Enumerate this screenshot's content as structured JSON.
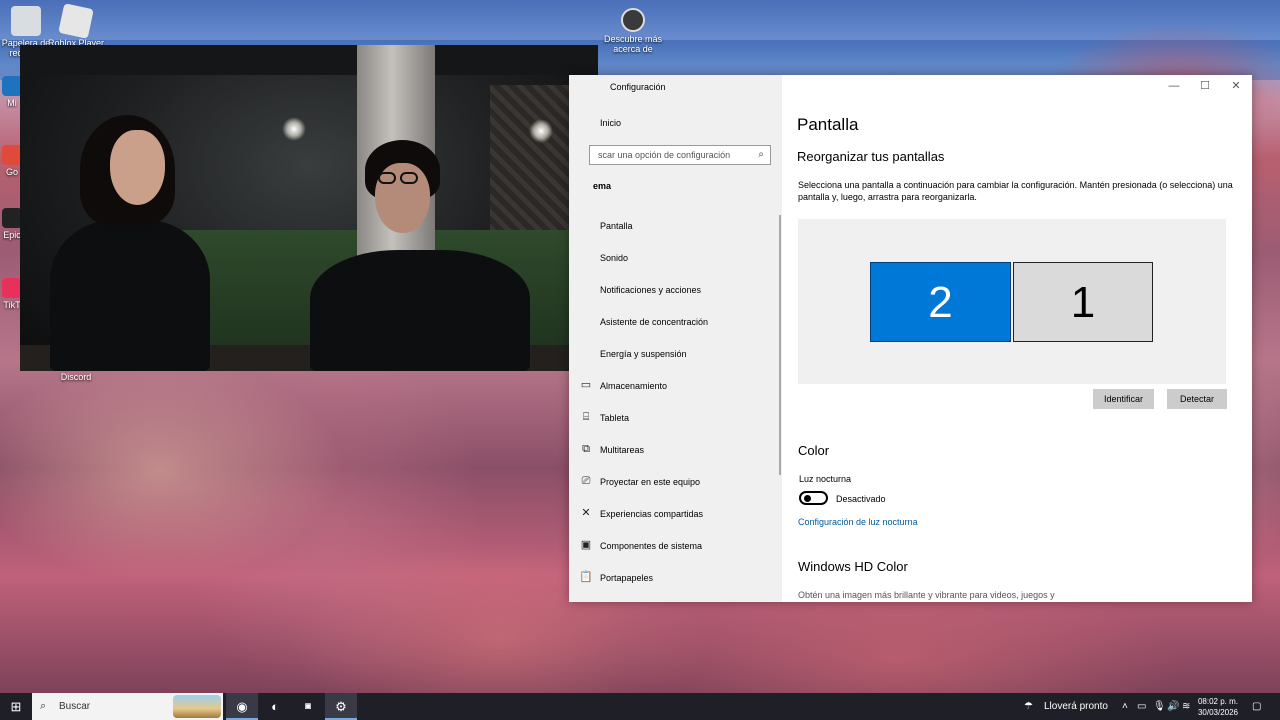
{
  "desktop": {
    "icons": [
      {
        "label": "Papelera de reciclaje",
        "color": "#dcdcdc"
      },
      {
        "label": "Roblox Player",
        "color": "#e8e8e8"
      },
      {
        "label": "Descubre más acerca de",
        "color": "#3a3a3a"
      },
      {
        "label": "Mi",
        "color": "#1e73be"
      },
      {
        "label": "Go",
        "color": "#e04a3a"
      },
      {
        "label": "Epic",
        "color": "#222222"
      },
      {
        "label": "TikT",
        "color": "#e8315a"
      },
      {
        "label": "Discord",
        "color": "#5865f2"
      }
    ]
  },
  "settings": {
    "window_title": "Configuración",
    "controls": {
      "minimize": "—",
      "maximize": "☐",
      "close": "✕"
    },
    "nav": {
      "home_label": "Inicio",
      "search_placeholder": "Buscar una opción de configuración",
      "search_shown_text": "scar una opción de configuración",
      "section_label": "ema",
      "items": [
        {
          "label": "Pantalla",
          "icon": "monitor-icon"
        },
        {
          "label": "Sonido",
          "icon": "speaker-icon"
        },
        {
          "label": "Notificaciones y acciones",
          "icon": "notification-icon"
        },
        {
          "label": "Asistente de concentración",
          "icon": "moon-icon"
        },
        {
          "label": "Energía y suspensión",
          "icon": "power-icon"
        },
        {
          "label": "Almacenamiento",
          "icon": "storage-icon"
        },
        {
          "label": "Tableta",
          "icon": "tablet-icon"
        },
        {
          "label": "Multitareas",
          "icon": "multitask-icon"
        },
        {
          "label": "Proyectar en este equipo",
          "icon": "project-icon"
        },
        {
          "label": "Experiencias compartidas",
          "icon": "shared-icon"
        },
        {
          "label": "Componentes de sistema",
          "icon": "components-icon"
        },
        {
          "label": "Portapapeles",
          "icon": "clipboard-icon"
        }
      ]
    },
    "main": {
      "page_title": "Pantalla",
      "rearrange_heading": "Reorganizar tus pantallas",
      "rearrange_desc": "Selecciona una pantalla a continuación para cambiar la configuración. Mantén presionada (o selecciona) una pantalla y, luego, arrastra para reorganizarla.",
      "monitors": {
        "second": "2",
        "first": "1"
      },
      "identify_label": "Identificar",
      "detect_label": "Detectar",
      "color_heading": "Color",
      "night_light_label": "Luz nocturna",
      "night_light_state": "Desactivado",
      "night_light_link": "Configuración de luz nocturna",
      "hdr_heading": "Windows HD Color",
      "hdr_desc": "Obtén una imagen más brillante y vibrante para videos, juegos y"
    }
  },
  "taskbar": {
    "search_label": "Buscar",
    "weather": "Lloverá pronto",
    "time": "08:02 p. m.",
    "date": "30/03/2026",
    "accent": "#0078d7"
  }
}
